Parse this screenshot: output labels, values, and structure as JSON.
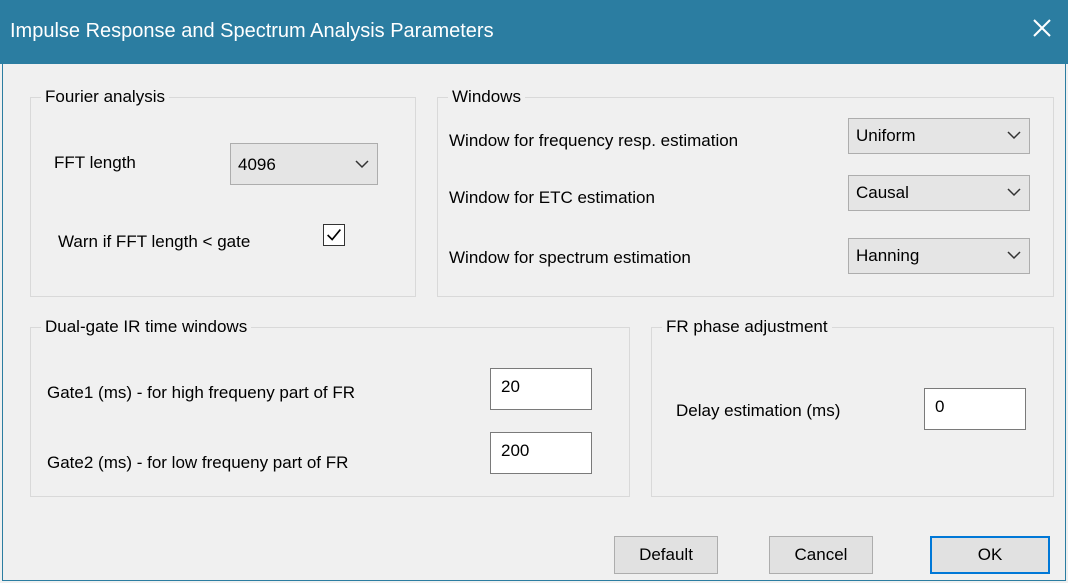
{
  "window": {
    "title": "Impulse Response and Spectrum Analysis Parameters",
    "close_icon": "close-icon"
  },
  "fourier": {
    "legend": "Fourier analysis",
    "fft_label": "FFT length",
    "fft_value": "4096",
    "warn_label": "Warn if FFT length < gate",
    "warn_checked": true
  },
  "windows": {
    "legend": "Windows",
    "freq_label": "Window for frequency resp. estimation",
    "freq_value": "Uniform",
    "etc_label": "Window for ETC estimation",
    "etc_value": "Causal",
    "spectrum_label": "Window for spectrum estimation",
    "spectrum_value": "Hanning"
  },
  "dualgate": {
    "legend": "Dual-gate IR time windows",
    "gate1_label": "Gate1 (ms) - for high frequeny part of FR",
    "gate1_value": "20",
    "gate2_label": "Gate2 (ms) - for low frequeny part of  FR",
    "gate2_value": "200"
  },
  "phase": {
    "legend": "FR phase adjustment",
    "delay_label": "Delay estimation (ms)",
    "delay_value": "0"
  },
  "buttons": {
    "default": "Default",
    "cancel": "Cancel",
    "ok": "OK"
  },
  "colors": {
    "titlebar": "#2b7da1",
    "focus_border": "#0078d7",
    "dialog_bg": "#f0f0f0"
  }
}
